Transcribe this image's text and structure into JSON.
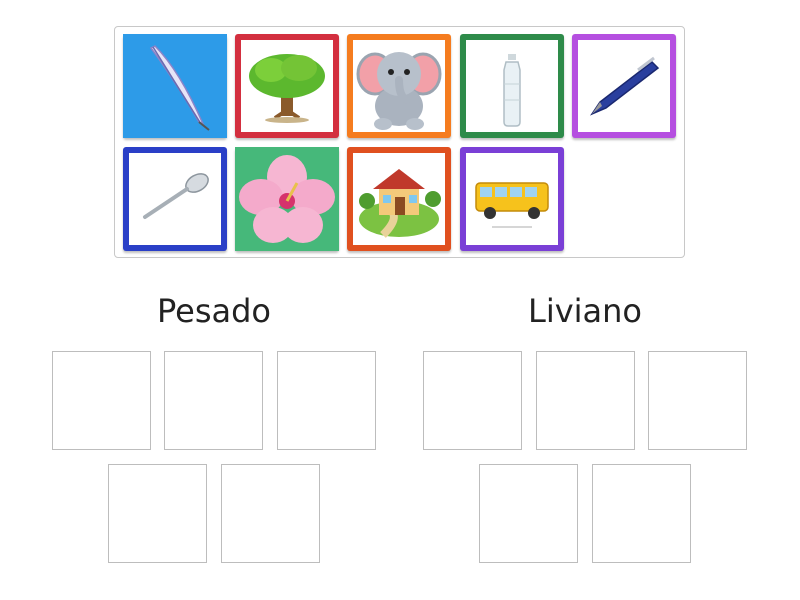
{
  "tray": {
    "cards": [
      {
        "name": "feather",
        "border": "#2196e6"
      },
      {
        "name": "tree",
        "border": "#d32f3f"
      },
      {
        "name": "elephant",
        "border": "#f57c1f"
      },
      {
        "name": "water-bottle",
        "border": "#2e8b4a"
      },
      {
        "name": "pen",
        "border": "#b54fe0"
      },
      {
        "name": "spoon",
        "border": "#2a3fc7"
      },
      {
        "name": "hibiscus-flower",
        "border": "#46b87a"
      },
      {
        "name": "house",
        "border": "#e0501f"
      },
      {
        "name": "school-bus",
        "border": "#7a3fd6"
      }
    ]
  },
  "groups": [
    {
      "title": "Pesado",
      "slots": 5
    },
    {
      "title": "Liviano",
      "slots": 5
    }
  ]
}
